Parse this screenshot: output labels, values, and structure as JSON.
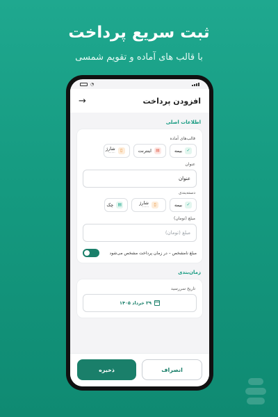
{
  "hero": {
    "title": "ثبت سریع پرداخت",
    "subtitle": "با قالب های آماده و تقویم شمسی"
  },
  "appbar": {
    "title": "افزودن پرداخت",
    "back_icon": "arrow-right-icon"
  },
  "main": {
    "section_label": "اطلاعات اصلی",
    "templates": {
      "label": "قالب‌های آماده",
      "chips": [
        {
          "label": "بیمه",
          "icon": "shield-icon",
          "color": "#1fa88f"
        },
        {
          "label": "اینترنت",
          "icon": "wifi-icon",
          "color": "#e25a46"
        },
        {
          "label": "شارژ",
          "icon": "phone-icon",
          "color": "#e58a2e"
        }
      ]
    },
    "title_field": {
      "label": "عنوان",
      "value": "عنوان"
    },
    "category": {
      "label": "دسته‌بندی",
      "chips": [
        {
          "label": "بیمه",
          "icon": "shield-icon",
          "color": "#1fa88f"
        },
        {
          "label": "شارژ",
          "icon": "phone-icon",
          "color": "#e58a2e"
        },
        {
          "label": "چک",
          "icon": "check-doc-icon",
          "color": "#1fa88f"
        }
      ]
    },
    "amount": {
      "label": "مبلغ (تومان)",
      "placeholder": "مبلغ (تومان)"
    },
    "toggle": {
      "text": "مبلغ نامشخص – در زمان پرداخت مشخص می‌شود",
      "on": true
    }
  },
  "schedule": {
    "section_label": "زمان‌بندی",
    "due_label": "تاریخ سررسید",
    "due_value": "۲۹ خرداد ۱۴۰۵"
  },
  "footer": {
    "save_label": "ذخیره",
    "cancel_label": "انصراف"
  },
  "colors": {
    "accent": "#1a7f6a",
    "background": "#159a80"
  }
}
